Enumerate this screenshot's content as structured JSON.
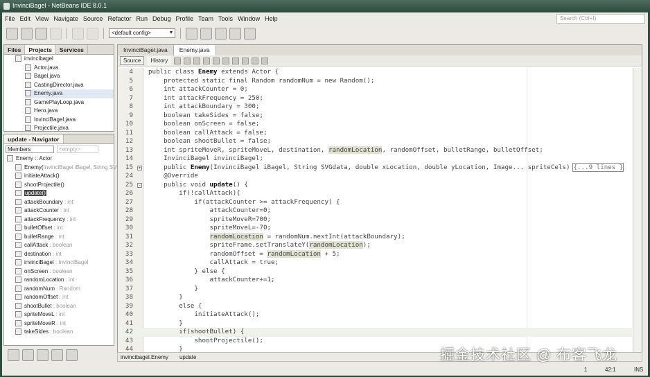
{
  "window": {
    "title": "InvinciBagel - NetBeans IDE 8.0.1"
  },
  "menu": [
    "File",
    "Edit",
    "View",
    "Navigate",
    "Source",
    "Refactor",
    "Run",
    "Debug",
    "Profile",
    "Team",
    "Tools",
    "Window",
    "Help"
  ],
  "search": {
    "placeholder": "Search (Ctrl+I)"
  },
  "toolbar": {
    "config": "<default config>"
  },
  "projects": {
    "tabs": [
      "Files",
      "Projects",
      "Services"
    ],
    "root": "invincibagel",
    "files": [
      "Actor.java",
      "Bagel.java",
      "CastingDirector.java",
      "Enemy.java",
      "GamePlayLoop.java",
      "Hero.java",
      "InvinciBagel.java",
      "Projectile.java"
    ],
    "selected": "Enemy.java"
  },
  "navigator": {
    "title": "update - Navigator",
    "filter": "Members",
    "filter2": "<empty>",
    "class": "Enemy :: Actor",
    "members": [
      {
        "name": "Enemy(",
        "type": "InvinciBagel iBagel, String SVG"
      },
      {
        "name": "initiateAttack()",
        "type": ""
      },
      {
        "name": "shootProjectile()",
        "type": ""
      },
      {
        "name": "update()",
        "type": "",
        "selected": true
      },
      {
        "name": "attackBoundary",
        "type": " : int"
      },
      {
        "name": "attackCounter",
        "type": " : int"
      },
      {
        "name": "attackFrequency",
        "type": " : int"
      },
      {
        "name": "bulletOffset",
        "type": " : int"
      },
      {
        "name": "bulletRange",
        "type": " : int"
      },
      {
        "name": "callAttack",
        "type": " : boolean"
      },
      {
        "name": "destination",
        "type": " : int"
      },
      {
        "name": "invinciBagel",
        "type": " : InvinciBagel"
      },
      {
        "name": "onScreen",
        "type": " : boolean"
      },
      {
        "name": "randomLocation",
        "type": " : int"
      },
      {
        "name": "randomNum",
        "type": " : Random"
      },
      {
        "name": "randomOffset",
        "type": " : int"
      },
      {
        "name": "shootBullet",
        "type": " : boolean"
      },
      {
        "name": "spriteMoveL",
        "type": " : int"
      },
      {
        "name": "spriteMoveR",
        "type": " : int"
      },
      {
        "name": "takeSides",
        "type": " : boolean"
      }
    ]
  },
  "editor": {
    "tabs": [
      "InvinciBagel.java",
      "Enemy.java"
    ],
    "active_tab": "Enemy.java",
    "source_btn": "Source",
    "history_btn": "History",
    "fold_label": "{...9 lines }",
    "lines": [
      {
        "n": "4",
        "seg": [
          [
            "public class ",
            ""
          ],
          [
            "Enemy",
            "b"
          ],
          [
            " extends Actor {",
            ""
          ]
        ]
      },
      {
        "n": "5",
        "seg": [
          [
            "    protected static final Random randomNum = new Random();",
            ""
          ]
        ]
      },
      {
        "n": "6",
        "seg": [
          [
            "    int attackCounter = 0;",
            ""
          ]
        ]
      },
      {
        "n": "7",
        "seg": [
          [
            "    int attackFrequency = 250;",
            ""
          ]
        ]
      },
      {
        "n": "8",
        "seg": [
          [
            "    int attackBoundary = 300;",
            ""
          ]
        ]
      },
      {
        "n": "9",
        "seg": [
          [
            "    boolean takeSides = false;",
            ""
          ]
        ]
      },
      {
        "n": "10",
        "seg": [
          [
            "    boolean onScreen = false;",
            ""
          ]
        ]
      },
      {
        "n": "11",
        "seg": [
          [
            "    boolean callAttack = false;",
            ""
          ]
        ]
      },
      {
        "n": "12",
        "seg": [
          [
            "    boolean shootBullet = false;",
            ""
          ]
        ]
      },
      {
        "n": "13",
        "seg": [
          [
            "    int spriteMoveR, spriteMoveL, destination, ",
            ""
          ],
          [
            "randomLocation",
            "hl"
          ],
          [
            ", randomOffset, bulletRange, bulletOffset;",
            ""
          ]
        ]
      },
      {
        "n": "14",
        "seg": [
          [
            "    InvinciBagel invinciBagel;",
            ""
          ]
        ]
      },
      {
        "n": "15",
        "fold": "+",
        "seg": [
          [
            "    public ",
            ""
          ],
          [
            "Enemy",
            "b"
          ],
          [
            "(InvinciBagel iBagel, String SVGdata, double xLocation, double yLocation, Image... spriteCels)",
            ""
          ]
        ],
        "folded": true
      },
      {
        "n": "24",
        "seg": [
          [
            "    @Override",
            ""
          ]
        ]
      },
      {
        "n": "25",
        "fold": "-",
        "seg": [
          [
            "    public void ",
            ""
          ],
          [
            "update",
            "b"
          ],
          [
            "() {",
            ""
          ]
        ]
      },
      {
        "n": "26",
        "seg": [
          [
            "        if(!callAttack){",
            ""
          ]
        ]
      },
      {
        "n": "27",
        "seg": [
          [
            "            if(attackCounter >= attackFrequency) {",
            ""
          ]
        ]
      },
      {
        "n": "28",
        "seg": [
          [
            "                attackCounter=0;",
            ""
          ]
        ]
      },
      {
        "n": "29",
        "seg": [
          [
            "                spriteMoveR=700;",
            ""
          ]
        ]
      },
      {
        "n": "30",
        "seg": [
          [
            "                spriteMoveL=-70;",
            ""
          ]
        ]
      },
      {
        "n": "31",
        "seg": [
          [
            "                ",
            ""
          ],
          [
            "randomLocation",
            "hl"
          ],
          [
            " = randomNum.nextInt(attackBoundary);",
            ""
          ]
        ]
      },
      {
        "n": "32",
        "seg": [
          [
            "                spriteFrame.setTranslateY(",
            ""
          ],
          [
            "randomLocation",
            "hl"
          ],
          [
            ");",
            ""
          ]
        ]
      },
      {
        "n": "33",
        "seg": [
          [
            "                randomOffset = ",
            ""
          ],
          [
            "randomLocation",
            "hl"
          ],
          [
            " + 5;",
            ""
          ]
        ]
      },
      {
        "n": "34",
        "seg": [
          [
            "                callAttack = true;",
            ""
          ]
        ]
      },
      {
        "n": "35",
        "seg": [
          [
            "            } else {",
            ""
          ]
        ]
      },
      {
        "n": "36",
        "seg": [
          [
            "                attackCounter+=1;",
            ""
          ]
        ]
      },
      {
        "n": "37",
        "seg": [
          [
            "            }",
            ""
          ]
        ]
      },
      {
        "n": "38",
        "seg": [
          [
            "        }",
            ""
          ]
        ]
      },
      {
        "n": "39",
        "seg": [
          [
            "        else {",
            ""
          ]
        ]
      },
      {
        "n": "40",
        "seg": [
          [
            "            initiateAttack();",
            ""
          ]
        ]
      },
      {
        "n": "41",
        "seg": [
          [
            "        }",
            ""
          ]
        ]
      },
      {
        "n": "42",
        "seg": [
          [
            "        if(shootBullet) {",
            ""
          ]
        ],
        "current": true
      },
      {
        "n": "43",
        "seg": [
          [
            "            shootProjectile();",
            ""
          ]
        ]
      },
      {
        "n": "44",
        "seg": [
          [
            "        }",
            ""
          ]
        ]
      }
    ]
  },
  "breadcrumb": [
    "invincibagel.Enemy",
    "update"
  ],
  "status": {
    "position": "42:1",
    "mode": "INS",
    "notifications": "1"
  },
  "watermark": "掘金技术社区 @ 布客飞龙"
}
